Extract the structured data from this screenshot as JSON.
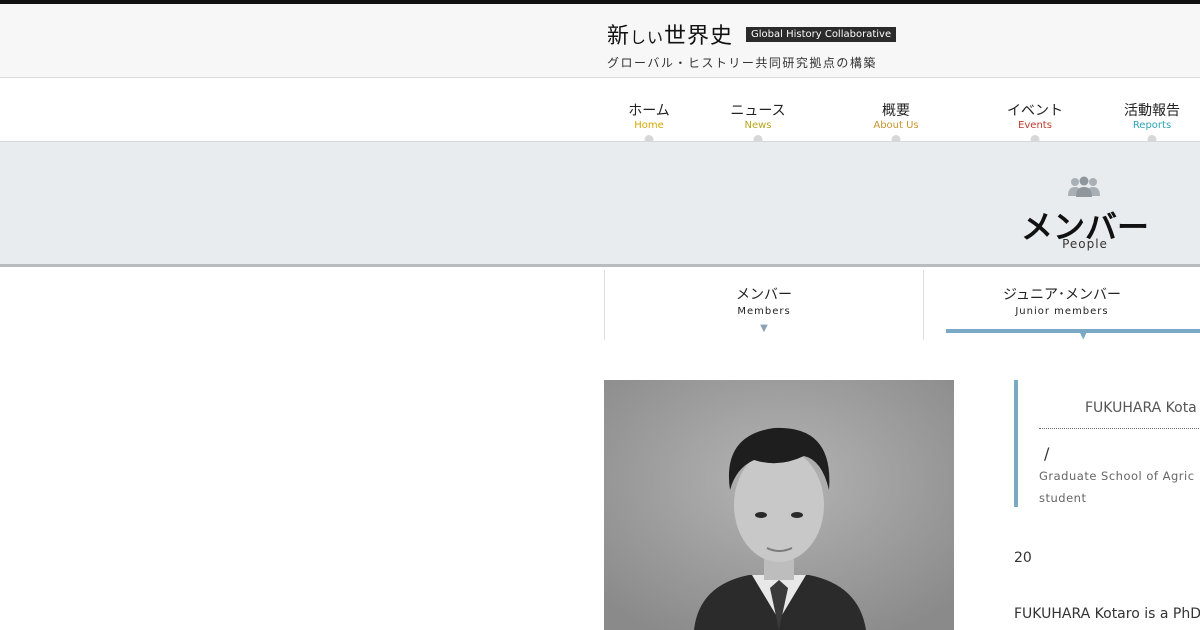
{
  "header": {
    "logo_jp_a": "新",
    "logo_jp_b": "しい",
    "logo_jp_c": "世界史",
    "badge": "Global History Collaborative",
    "subtitle": "グローバル・ヒストリー共同研究拠点の構築"
  },
  "nav": [
    {
      "jp": "ホーム",
      "en": "Home",
      "color": "#d4a800"
    },
    {
      "jp": "ニュース",
      "en": "News",
      "color": "#b7a51a"
    },
    {
      "jp": "概要",
      "en": "About Us",
      "color": "#c8952d"
    },
    {
      "jp": "イベント",
      "en": "Events",
      "color": "#c0392b"
    },
    {
      "jp": "活動報告",
      "en": "Reports",
      "color": "#2aa3b5"
    }
  ],
  "banner": {
    "icon": "people-icon",
    "title": "メンバー",
    "subtitle": "People"
  },
  "tabs": {
    "members": {
      "jp": "メンバー",
      "en": "Members"
    },
    "junior": {
      "jp": "ジュニア･メンバー",
      "en": "Junior members"
    },
    "arrow": "▼",
    "accent": "#7aa9c6"
  },
  "profile": {
    "name": "FUKUHARA Kota",
    "slash": "/",
    "affiliation_line1": "Graduate School of Agric",
    "affiliation_line2": "student"
  },
  "year": "20",
  "bio": "FUKUHARA Kotaro is a PhD"
}
